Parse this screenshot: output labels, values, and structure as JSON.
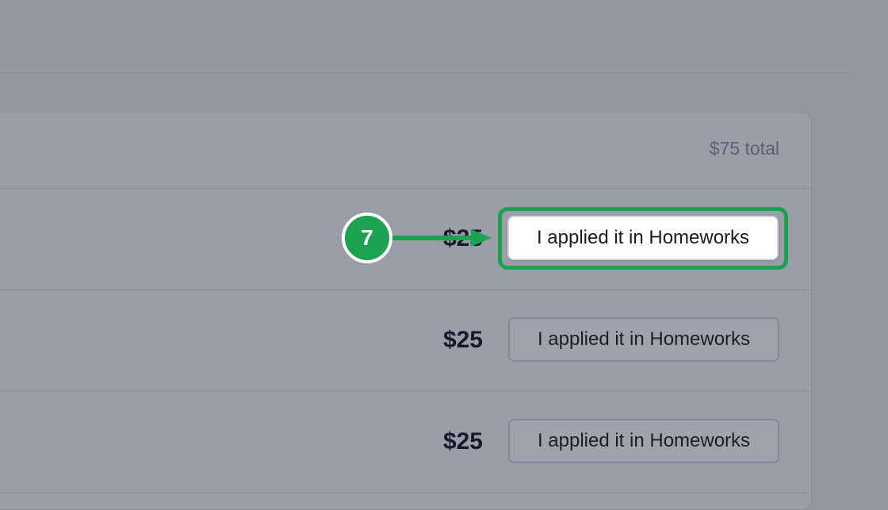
{
  "summary": {
    "total": "$75 total"
  },
  "rows": [
    {
      "amount": "$25",
      "action_label": "I applied it in Homeworks"
    },
    {
      "amount": "$25",
      "action_label": "I applied it in Homeworks"
    },
    {
      "amount": "$25",
      "action_label": "I applied it in Homeworks"
    }
  ],
  "annotation": {
    "step_number": "7",
    "accent_color": "#1ca352"
  },
  "colors": {
    "overlay_background": "#9497a2",
    "card_background": "#9b9ea8",
    "focused_button_background": "#ffffff"
  }
}
